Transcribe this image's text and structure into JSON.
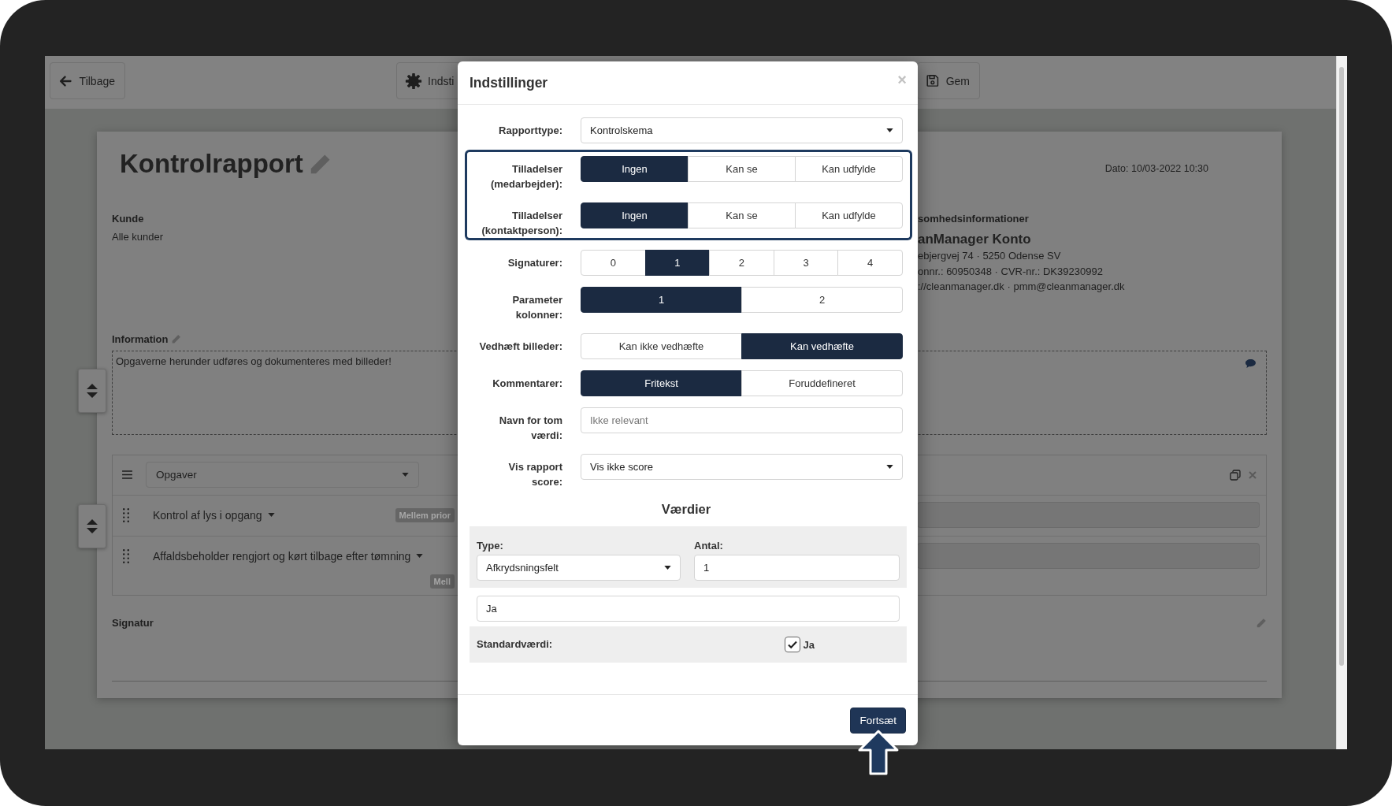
{
  "toolbar": {
    "buttons": [
      {
        "label": "Tilbage"
      },
      {
        "label": "Indsti"
      },
      {
        "label": "Gem"
      }
    ]
  },
  "report": {
    "title": "Kontrolrapport",
    "date": "Dato: 10/03-2022 10:30",
    "customer": {
      "label": "Kunde",
      "value": "Alle kunder"
    },
    "company": {
      "heading": "somhedsinformationer",
      "name": "anManager Konto",
      "lines": [
        "ebjergvej 74 · 5250 Odense SV",
        "onnr.: 60950348 · CVR-nr.: DK39230992",
        "://cleanmanager.dk · pmm@cleanmanager.dk"
      ]
    },
    "information": {
      "label": "Information",
      "text": "Opgaverne herunder udføres og dokumenteres med billeder!"
    },
    "tasks": {
      "group": "Opgaver",
      "items": [
        {
          "name": "Kontrol af lys i opgang",
          "priority": "Mellem prior"
        },
        {
          "name": "Affaldsbeholder rengjort og kørt tilbage efter tømning",
          "priority": "Mell"
        }
      ]
    },
    "signature": {
      "label": "Signatur"
    }
  },
  "dialog": {
    "title": "Indstillinger",
    "close": "×",
    "rows": [
      {
        "label": "Rapporttype:",
        "kind": "select",
        "value": "Kontrolskema",
        "highlighted": false
      },
      {
        "label": "Tilladelser (medarbejder):",
        "kind": "segmented",
        "highlighted": true,
        "options": [
          {
            "label": "Ingen",
            "selected": true
          },
          {
            "label": "Kan se",
            "selected": false
          },
          {
            "label": "Kan udfylde",
            "selected": false
          }
        ]
      },
      {
        "label": "Tilladelser (kontaktperson):",
        "kind": "segmented",
        "highlighted": true,
        "options": [
          {
            "label": "Ingen",
            "selected": true
          },
          {
            "label": "Kan se",
            "selected": false
          },
          {
            "label": "Kan udfylde",
            "selected": false
          }
        ]
      },
      {
        "label": "Signaturer:",
        "kind": "segmented",
        "highlighted": false,
        "options": [
          {
            "label": "0",
            "selected": false
          },
          {
            "label": "1",
            "selected": true
          },
          {
            "label": "2",
            "selected": false
          },
          {
            "label": "3",
            "selected": false
          },
          {
            "label": "4",
            "selected": false
          }
        ]
      },
      {
        "label": "Parameter kolonner:",
        "kind": "segmented",
        "highlighted": false,
        "options": [
          {
            "label": "1",
            "selected": true
          },
          {
            "label": "2",
            "selected": false
          }
        ]
      },
      {
        "label": "Vedhæft billeder:",
        "kind": "segmented",
        "highlighted": false,
        "options": [
          {
            "label": "Kan ikke vedhæfte",
            "selected": false
          },
          {
            "label": "Kan vedhæfte",
            "selected": true
          }
        ]
      },
      {
        "label": "Kommentarer:",
        "kind": "segmented",
        "highlighted": false,
        "options": [
          {
            "label": "Fritekst",
            "selected": true
          },
          {
            "label": "Foruddefineret",
            "selected": false
          }
        ]
      },
      {
        "label": "Navn for tom værdi:",
        "kind": "input",
        "placeholder": "Ikke relevant",
        "highlighted": false
      },
      {
        "label": "Vis rapport score:",
        "kind": "select",
        "value": "Vis ikke score",
        "highlighted": false
      }
    ],
    "values": {
      "heading": "Værdier",
      "type_label": "Type:",
      "type_value": "Afkrydsningsfelt",
      "count_label": "Antal:",
      "count_value": "1",
      "value_field": "Ja",
      "default_label": "Standardværdi:",
      "default_option": {
        "label": "Ja",
        "checked": true
      }
    },
    "button": "Fortsæt"
  }
}
